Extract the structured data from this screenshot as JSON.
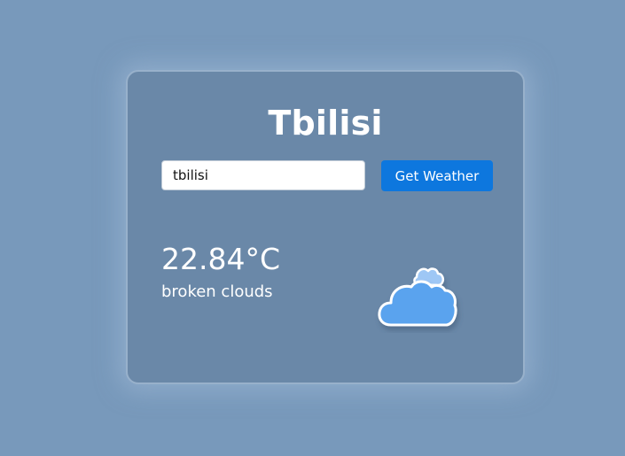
{
  "weather": {
    "city": "Tbilisi",
    "search_value": "tbilisi",
    "button_label": "Get Weather",
    "temperature": "22.84°C",
    "description": "broken clouds",
    "icon": "broken-clouds-icon"
  },
  "colors": {
    "background": "#7899bb",
    "card": "#6a88a8",
    "button": "#0d77de",
    "cloud_front": "#5aa3ee",
    "cloud_back": "#9ec7f5"
  }
}
